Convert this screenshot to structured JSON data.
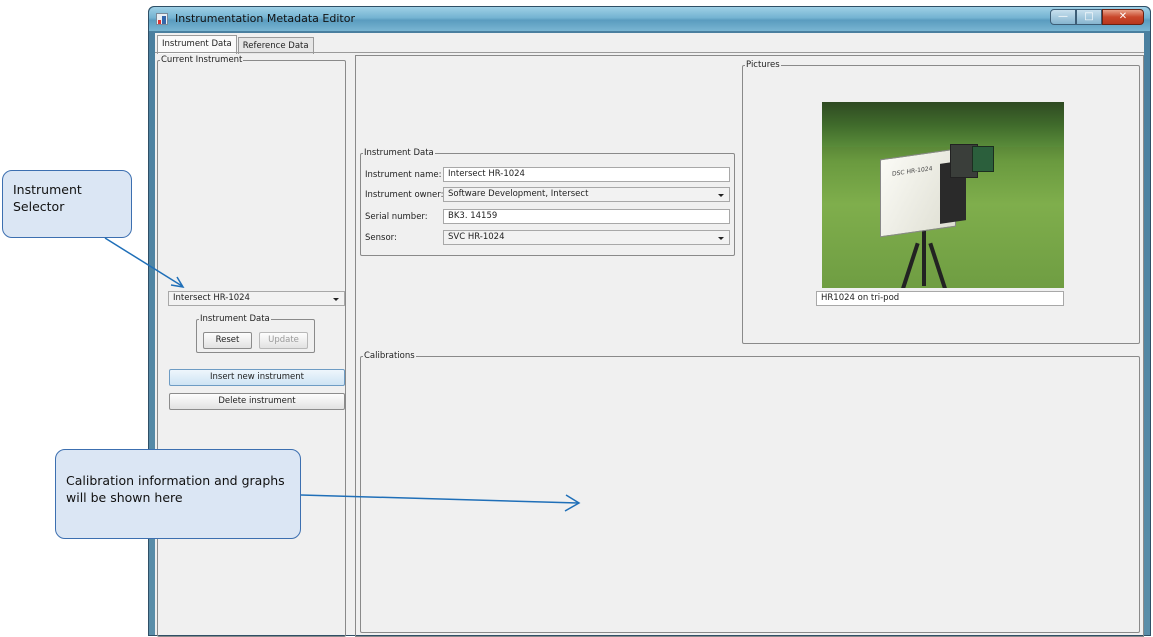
{
  "window": {
    "title": "Instrumentation Metadata Editor",
    "buttons": {
      "minimize": "—",
      "maximize": "□",
      "close": "✕"
    }
  },
  "tabs": [
    {
      "label": "Instrument Data",
      "active": true
    },
    {
      "label": "Reference Data",
      "active": false
    }
  ],
  "current_instrument": {
    "legend": "Current Instrument",
    "selector_value": "Intersect HR-1024",
    "instrument_data_group": {
      "legend": "Instrument Data",
      "reset_label": "Reset",
      "update_label": "Update"
    },
    "insert_label": "Insert new instrument",
    "delete_label": "Delete instrument"
  },
  "instrument_data": {
    "legend": "Instrument Data",
    "fields": {
      "name_label": "Instrument name:",
      "name_value": "Intersect HR-1024",
      "owner_label": "Instrument owner:",
      "owner_value": "Software Development, Intersect",
      "serial_label": "Serial number:",
      "serial_value": "BK3. 14159",
      "sensor_label": "Sensor:",
      "sensor_value": "SVC HR-1024"
    }
  },
  "pictures": {
    "legend": "Pictures",
    "caption": "HR1024 on tri-pod",
    "camera_logo": "DSC HR-1024"
  },
  "calibrations": {
    "legend": "Calibrations"
  },
  "callouts": {
    "selector": "Instrument Selector",
    "calibration": "Calibration information and graphs will be shown here"
  },
  "colors": {
    "callout_fill": "#dbe6f4",
    "callout_border": "#3c6fb0",
    "arrow": "#1f6fb8"
  }
}
